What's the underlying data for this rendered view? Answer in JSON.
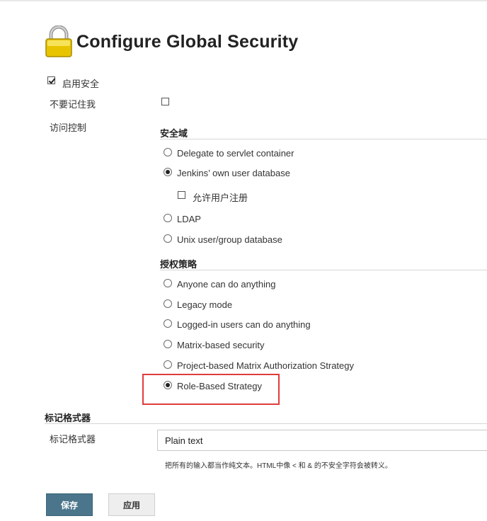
{
  "page": {
    "title": "Configure Global Security"
  },
  "enable_security": {
    "label": "启用安全",
    "checked": true
  },
  "no_remember_me": {
    "label": "不要记住我",
    "checked": false
  },
  "access_control": {
    "label": "访问控制"
  },
  "security_realm": {
    "heading": "安全域",
    "options": [
      {
        "label": "Delegate to servlet container",
        "selected": false
      },
      {
        "label": "Jenkins’ own user database",
        "selected": true
      },
      {
        "label": "LDAP",
        "selected": false
      },
      {
        "label": "Unix user/group database",
        "selected": false
      }
    ],
    "allow_signup": {
      "label": "允许用户注册",
      "checked": false
    }
  },
  "authorization": {
    "heading": "授权策略",
    "options": [
      {
        "label": "Anyone can do anything",
        "selected": false
      },
      {
        "label": "Legacy mode",
        "selected": false
      },
      {
        "label": "Logged-in users can do anything",
        "selected": false
      },
      {
        "label": "Matrix-based security",
        "selected": false
      },
      {
        "label": "Project-based Matrix Authorization Strategy",
        "selected": false
      },
      {
        "label": "Role-Based Strategy",
        "selected": true
      }
    ]
  },
  "markup_formatter": {
    "section_heading": "标记格式器",
    "field_label": "标记格式器",
    "value": "Plain text",
    "hint": "把所有的输入都当作纯文本。HTML中像 < 和 & 的不安全字符会被转义。"
  },
  "buttons": {
    "save": "保存",
    "apply": "应用"
  },
  "colors": {
    "save_button": "#4b758b",
    "highlight_border": "#e03c3c"
  }
}
